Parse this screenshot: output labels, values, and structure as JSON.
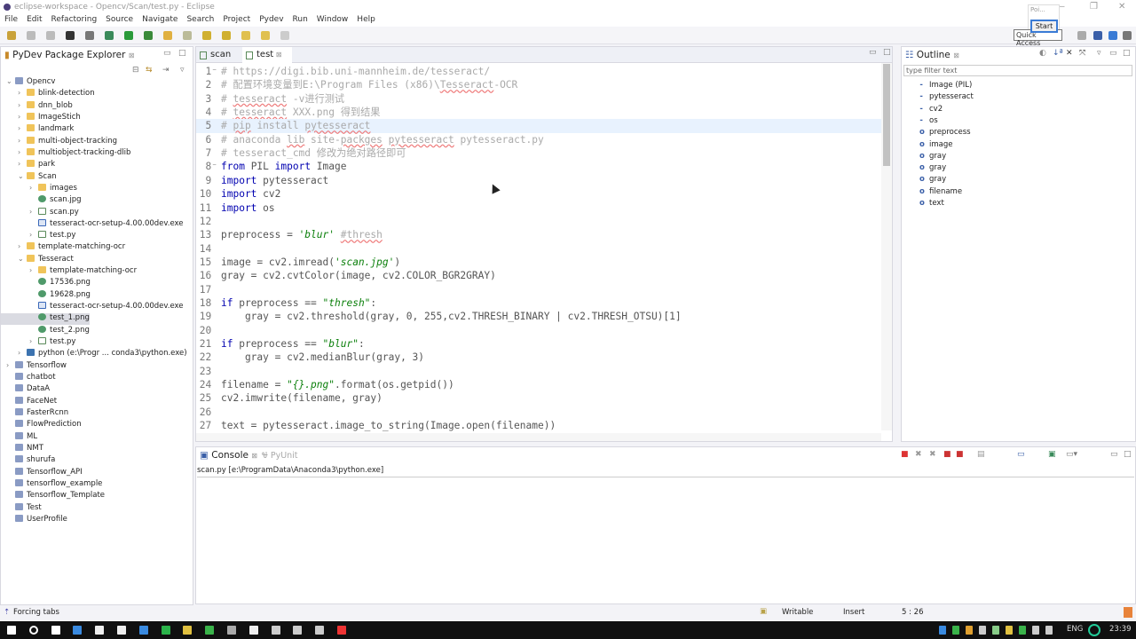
{
  "window": {
    "title": "eclipse-workspace - Opencv/Scan/test.py - Eclipse"
  },
  "menu": [
    "File",
    "Edit",
    "Refactoring",
    "Source",
    "Navigate",
    "Search",
    "Project",
    "Pydev",
    "Run",
    "Window",
    "Help"
  ],
  "quick_access": {
    "placeholder": "Quick Access",
    "popup_label": "Poi...",
    "start_button": "Start"
  },
  "explorer": {
    "title": "PyDev Package Explorer",
    "items": [
      {
        "label": "Opencv",
        "level": 0,
        "icon": "project",
        "expanded": true
      },
      {
        "label": "blink-detection",
        "level": 1,
        "icon": "folder"
      },
      {
        "label": "dnn_blob",
        "level": 1,
        "icon": "folder"
      },
      {
        "label": "ImageStich",
        "level": 1,
        "icon": "folder"
      },
      {
        "label": "landmark",
        "level": 1,
        "icon": "folder"
      },
      {
        "label": "multi-object-tracking",
        "level": 1,
        "icon": "folder"
      },
      {
        "label": "multiobject-tracking-dlib",
        "level": 1,
        "icon": "folder"
      },
      {
        "label": "park",
        "level": 1,
        "icon": "folder"
      },
      {
        "label": "Scan",
        "level": 1,
        "icon": "folder",
        "expanded": true
      },
      {
        "label": "images",
        "level": 2,
        "icon": "folder"
      },
      {
        "label": "scan.jpg",
        "level": 2,
        "icon": "image",
        "leaf": true
      },
      {
        "label": "scan.py",
        "level": 2,
        "icon": "python-file"
      },
      {
        "label": "tesseract-ocr-setup-4.00.00dev.exe",
        "level": 2,
        "icon": "exe",
        "leaf": true
      },
      {
        "label": "test.py",
        "level": 2,
        "icon": "python-file"
      },
      {
        "label": "template-matching-ocr",
        "level": 1,
        "icon": "folder"
      },
      {
        "label": "Tesseract",
        "level": 1,
        "icon": "folder",
        "expanded": true
      },
      {
        "label": "template-matching-ocr",
        "level": 2,
        "icon": "folder"
      },
      {
        "label": "17536.png",
        "level": 2,
        "icon": "image",
        "leaf": true
      },
      {
        "label": "19628.png",
        "level": 2,
        "icon": "image",
        "leaf": true
      },
      {
        "label": "tesseract-ocr-setup-4.00.00dev.exe",
        "level": 2,
        "icon": "exe",
        "leaf": true
      },
      {
        "label": "test_1.png",
        "level": 2,
        "icon": "image",
        "leaf": true,
        "selected": true
      },
      {
        "label": "test_2.png",
        "level": 2,
        "icon": "image",
        "leaf": true
      },
      {
        "label": "test.py",
        "level": 2,
        "icon": "python-file"
      },
      {
        "label": "python  (e:\\Progr ... conda3\\python.exe)",
        "level": 1,
        "icon": "python-interpreter"
      },
      {
        "label": "Tensorflow",
        "level": 0,
        "icon": "project"
      },
      {
        "label": "chatbot",
        "level": 0,
        "icon": "project",
        "leaf": true
      },
      {
        "label": "DataA",
        "level": 0,
        "icon": "project",
        "leaf": true
      },
      {
        "label": "FaceNet",
        "level": 0,
        "icon": "project",
        "leaf": true
      },
      {
        "label": "FasterRcnn",
        "level": 0,
        "icon": "project",
        "leaf": true
      },
      {
        "label": "FlowPrediction",
        "level": 0,
        "icon": "project",
        "leaf": true
      },
      {
        "label": "ML",
        "level": 0,
        "icon": "project",
        "leaf": true
      },
      {
        "label": "NMT",
        "level": 0,
        "icon": "project",
        "leaf": true
      },
      {
        "label": "shurufa",
        "level": 0,
        "icon": "project",
        "leaf": true
      },
      {
        "label": "Tensorflow_API",
        "level": 0,
        "icon": "project",
        "leaf": true
      },
      {
        "label": "tensorflow_example",
        "level": 0,
        "icon": "project",
        "leaf": true
      },
      {
        "label": "Tensorflow_Template",
        "level": 0,
        "icon": "project",
        "leaf": true
      },
      {
        "label": "Test",
        "level": 0,
        "icon": "project",
        "leaf": true
      },
      {
        "label": "UserProfile",
        "level": 0,
        "icon": "project",
        "leaf": true
      }
    ]
  },
  "editor": {
    "tabs": [
      {
        "label": "scan",
        "active": false
      },
      {
        "label": "test",
        "active": true
      }
    ],
    "highlighted_line": 5,
    "lines": [
      [
        [
          "c",
          "# https://digi.bib.uni-mannheim.de/tesseract/"
        ]
      ],
      [
        [
          "c",
          "# 配置环境变量到E:\\Program Files (x86)\\"
        ],
        [
          "cu",
          "Tesseract"
        ],
        [
          "c",
          "-OCR"
        ]
      ],
      [
        [
          "c",
          "# "
        ],
        [
          "cu",
          "tesseract"
        ],
        [
          "c",
          " -v进行测试"
        ]
      ],
      [
        [
          "c",
          "# "
        ],
        [
          "cu",
          "tesseract"
        ],
        [
          "c",
          " XXX.png 得到结果"
        ]
      ],
      [
        [
          "c",
          "# "
        ],
        [
          "cu",
          "pip"
        ],
        [
          "c",
          " install "
        ],
        [
          "cu",
          "pytesseract"
        ]
      ],
      [
        [
          "c",
          "# anaconda "
        ],
        [
          "cu",
          "lib"
        ],
        [
          "c",
          " site-"
        ],
        [
          "cu",
          "packges"
        ],
        [
          "c",
          " "
        ],
        [
          "cu",
          "pytesseract"
        ],
        [
          "c",
          " pytesseract.py"
        ]
      ],
      [
        [
          "c",
          "# tesseract_cmd 修改为绝对路径即可"
        ]
      ],
      [
        [
          "k",
          "from"
        ],
        [
          "n",
          " PIL "
        ],
        [
          "k",
          "import"
        ],
        [
          "n",
          " Image"
        ]
      ],
      [
        [
          "k",
          "import"
        ],
        [
          "n",
          " pytesseract"
        ]
      ],
      [
        [
          "k",
          "import"
        ],
        [
          "n",
          " cv2"
        ]
      ],
      [
        [
          "k",
          "import"
        ],
        [
          "n",
          " os"
        ]
      ],
      [],
      [
        [
          "n",
          "preprocess = "
        ],
        [
          "s",
          "'blur'"
        ],
        [
          "n",
          " "
        ],
        [
          "cu",
          "#thresh"
        ]
      ],
      [],
      [
        [
          "n",
          "image = cv2.imread("
        ],
        [
          "s",
          "'scan.jpg'"
        ],
        [
          "n",
          ")"
        ]
      ],
      [
        [
          "n",
          "gray = cv2.cvtColor(image, cv2.COLOR_BGR2GRAY)"
        ]
      ],
      [],
      [
        [
          "k",
          "if"
        ],
        [
          "n",
          " preprocess == "
        ],
        [
          "s",
          "\"thresh\""
        ],
        [
          "n",
          ":"
        ]
      ],
      [
        [
          "n",
          "    gray = cv2.threshold(gray, 0, 255,cv2.THRESH_BINARY | cv2.THRESH_OTSU)[1]"
        ]
      ],
      [],
      [
        [
          "k",
          "if"
        ],
        [
          "n",
          " preprocess == "
        ],
        [
          "s",
          "\"blur\""
        ],
        [
          "n",
          ":"
        ]
      ],
      [
        [
          "n",
          "    gray = cv2.medianBlur(gray, 3)"
        ]
      ],
      [],
      [
        [
          "n",
          "filename = "
        ],
        [
          "s",
          "\"{}.png\""
        ],
        [
          "n",
          ".format(os.getpid())"
        ]
      ],
      [
        [
          "n",
          "cv2.imwrite(filename, gray)"
        ]
      ],
      [],
      [
        [
          "n",
          "text = pytesseract.image_to_string(Image.open(filename))"
        ]
      ]
    ]
  },
  "outline": {
    "title": "Outline",
    "filter_placeholder": "type filter text",
    "items": [
      {
        "label": "Image (PIL)",
        "kind": "import"
      },
      {
        "label": "pytesseract",
        "kind": "import"
      },
      {
        "label": "cv2",
        "kind": "import"
      },
      {
        "label": "os",
        "kind": "import"
      },
      {
        "label": "preprocess",
        "kind": "variable"
      },
      {
        "label": "image",
        "kind": "variable"
      },
      {
        "label": "gray",
        "kind": "variable"
      },
      {
        "label": "gray",
        "kind": "variable"
      },
      {
        "label": "gray",
        "kind": "variable"
      },
      {
        "label": "filename",
        "kind": "variable"
      },
      {
        "label": "text",
        "kind": "variable"
      }
    ]
  },
  "console": {
    "tabs": [
      "Console",
      "PyUnit"
    ],
    "process": "scan.py [e:\\ProgramData\\Anaconda3\\python.exe]"
  },
  "status": {
    "message": "Forcing tabs",
    "writable": "Writable",
    "insert_mode": "Insert",
    "position": "5 : 26"
  },
  "taskbar": {
    "language": "ENG",
    "clock": "23:39"
  },
  "colors": {
    "keyword": "#0000b0",
    "string": "#0a7f0a",
    "comment": "#aaaaaa",
    "accent": "#3a7bd5"
  }
}
